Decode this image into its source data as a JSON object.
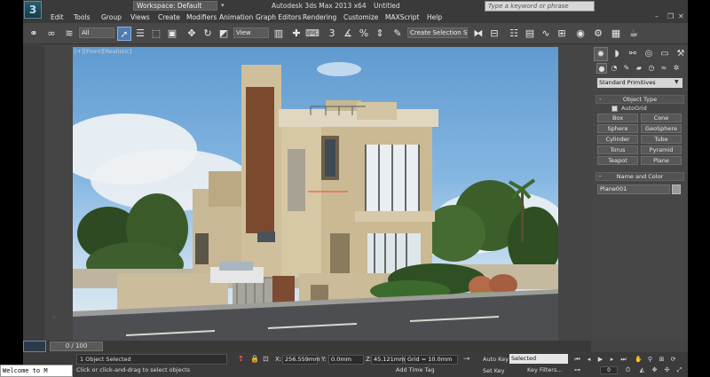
{
  "titlebar": {
    "workspace": "Workspace: Default",
    "app_title": "Autodesk 3ds Max  2013 x64",
    "doc_title": "Untitled",
    "search_placeholder": "Type a keyword or phrase"
  },
  "menubar": {
    "items": [
      "Edit",
      "Tools",
      "Group",
      "Views",
      "Create",
      "Modifiers",
      "Animation",
      "Graph Editors",
      "Rendering",
      "Customize",
      "MAXScript",
      "Help"
    ]
  },
  "toolbar": {
    "selection_filter": "All",
    "ref_coord": "View",
    "named_selection": "Create Selection Se",
    "snap_label": "3"
  },
  "viewport": {
    "label_parts": [
      "[+]",
      "[Front]",
      "[Realistic]"
    ]
  },
  "timeline": {
    "slider_text": "0 / 100"
  },
  "command_panel": {
    "category": "Standard Primitives",
    "object_type_title": "Object Type",
    "autogrid_label": "AutoGrid",
    "primitives": [
      "Box",
      "Cone",
      "Sphere",
      "GeoSphere",
      "Cylinder",
      "Tube",
      "Torus",
      "Pyramid",
      "Teapot",
      "Plane"
    ],
    "name_color_title": "Name and Color",
    "object_name": "Plane001",
    "swatch_color": "#9a9a9a"
  },
  "statusbar": {
    "welcome": "Welcome to M",
    "selection_info": "1 Object Selected",
    "prompt": "Click or click-and-drag to select objects",
    "x_label": "X:",
    "x_value": "256.559mm",
    "y_label": "Y:",
    "y_value": "0.0mm",
    "z_label": "Z:",
    "z_value": "45.121mm",
    "grid": "Grid = 10.0mm",
    "add_time_tag": "Add Time Tag",
    "auto_key": "Auto Key",
    "set_key": "Set Key",
    "key_mode": "Selected",
    "key_filters": "Key Filters...",
    "frame": "0"
  },
  "colors": {
    "ui_bg": "#444444",
    "active_tool": "#4e7bb2"
  }
}
